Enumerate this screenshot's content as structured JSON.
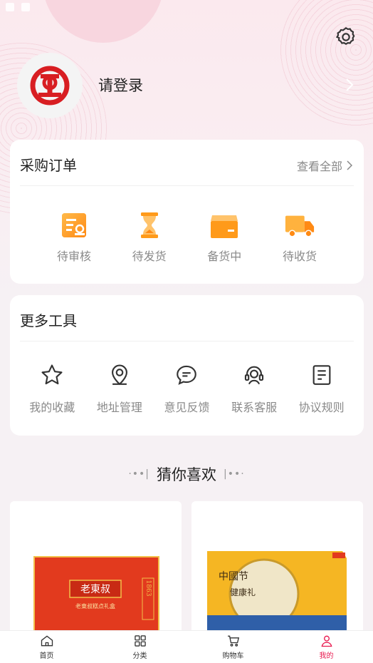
{
  "colors": {
    "accent": "#e8174d",
    "icon_orange": "#ff9a1a",
    "brand_red": "#d81e22"
  },
  "profile": {
    "login_label": "请登录"
  },
  "orders": {
    "title": "采购订单",
    "view_all": "查看全部",
    "items": [
      {
        "label": "待审核",
        "icon": "review-icon"
      },
      {
        "label": "待发货",
        "icon": "hourglass-icon"
      },
      {
        "label": "备货中",
        "icon": "box-icon"
      },
      {
        "label": "待收货",
        "icon": "truck-icon"
      }
    ]
  },
  "tools": {
    "title": "更多工具",
    "items": [
      {
        "label": "我的收藏",
        "icon": "star-icon"
      },
      {
        "label": "地址管理",
        "icon": "location-icon"
      },
      {
        "label": "意见反馈",
        "icon": "chat-icon"
      },
      {
        "label": "联系客服",
        "icon": "headset-icon"
      },
      {
        "label": "协议规则",
        "icon": "document-icon"
      }
    ]
  },
  "recommend": {
    "title": "猜你喜欢"
  },
  "products": [
    {
      "box_title": "老東叔",
      "box_sub": "老東叔糕点礼盒",
      "box_num": "1863"
    },
    {
      "box_title": "中國节",
      "box_sub": "健康礼"
    }
  ],
  "tabbar": {
    "items": [
      {
        "label": "首页",
        "icon": "home-icon"
      },
      {
        "label": "分类",
        "icon": "grid-icon"
      },
      {
        "label": "购物车",
        "icon": "cart-icon"
      },
      {
        "label": "我的",
        "icon": "person-icon",
        "active": true
      }
    ]
  }
}
